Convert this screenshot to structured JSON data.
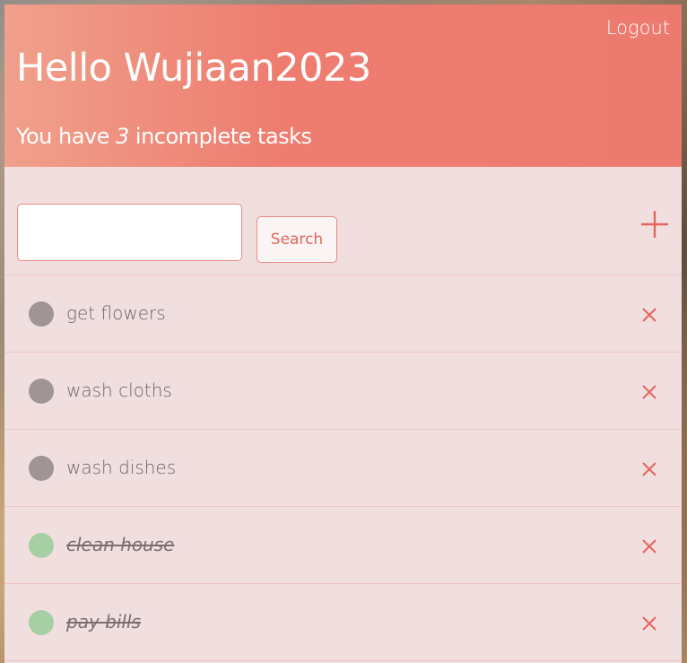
{
  "header": {
    "logout_label": "Logout",
    "greeting": "Hello Wujiaan2023",
    "summary_prefix": "You have ",
    "incomplete_count": "3",
    "summary_suffix": " incomplete tasks"
  },
  "toolbar": {
    "search_value": "",
    "search_placeholder": "",
    "search_button_label": "Search",
    "add_icon": "plus-icon"
  },
  "tasks": [
    {
      "label": "get flowers",
      "done": false
    },
    {
      "label": "wash cloths",
      "done": false
    },
    {
      "label": "wash dishes",
      "done": false
    },
    {
      "label": "clean house",
      "done": true
    },
    {
      "label": "pay bills",
      "done": true
    }
  ],
  "colors": {
    "header_start": "#f0a08c",
    "header_end": "#ed7a6f",
    "panel_bg": "#f1dfe0",
    "accent": "#e4665b",
    "incomplete_dot": "#a09495",
    "complete_dot": "#a7cfa4"
  }
}
